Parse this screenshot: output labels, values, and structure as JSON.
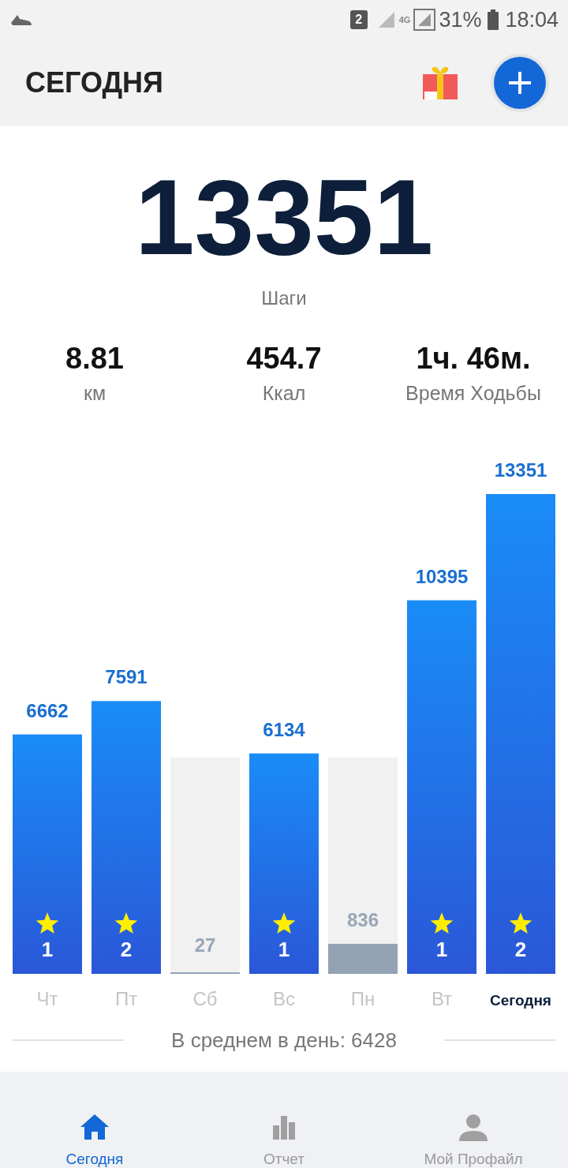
{
  "status_bar": {
    "sim_badge": "2",
    "network": "4G",
    "battery": "31%",
    "time": "18:04"
  },
  "header": {
    "title": "СЕГОДНЯ"
  },
  "steps": {
    "value": "13351",
    "label": "Шаги"
  },
  "stats": [
    {
      "value": "8.81",
      "label": "км"
    },
    {
      "value": "454.7",
      "label": "Ккал"
    },
    {
      "value": "1ч. 46м.",
      "label": "Время Ходьбы"
    }
  ],
  "chart_data": {
    "type": "bar",
    "categories": [
      "Чт",
      "Пт",
      "Сб",
      "Вс",
      "Пн",
      "Вт",
      "Сегодня"
    ],
    "values": [
      6662,
      7591,
      27,
      6134,
      836,
      10395,
      13351
    ],
    "data_labels": true
  },
  "bar_goals": [
    {
      "met": true,
      "stars_label": "1"
    },
    {
      "met": true,
      "stars_label": "2"
    },
    {
      "met": false
    },
    {
      "met": true,
      "stars_label": "1"
    },
    {
      "met": false
    },
    {
      "met": true,
      "stars_label": "1"
    },
    {
      "met": true,
      "stars_label": "2"
    }
  ],
  "average": "В среднем в день: 6428",
  "nav": [
    {
      "label": "Сегодня",
      "kind": "home",
      "selected": true
    },
    {
      "label": "Отчет",
      "kind": "report",
      "selected": false
    },
    {
      "label": "Мой Профайл",
      "kind": "profile",
      "selected": false
    }
  ]
}
